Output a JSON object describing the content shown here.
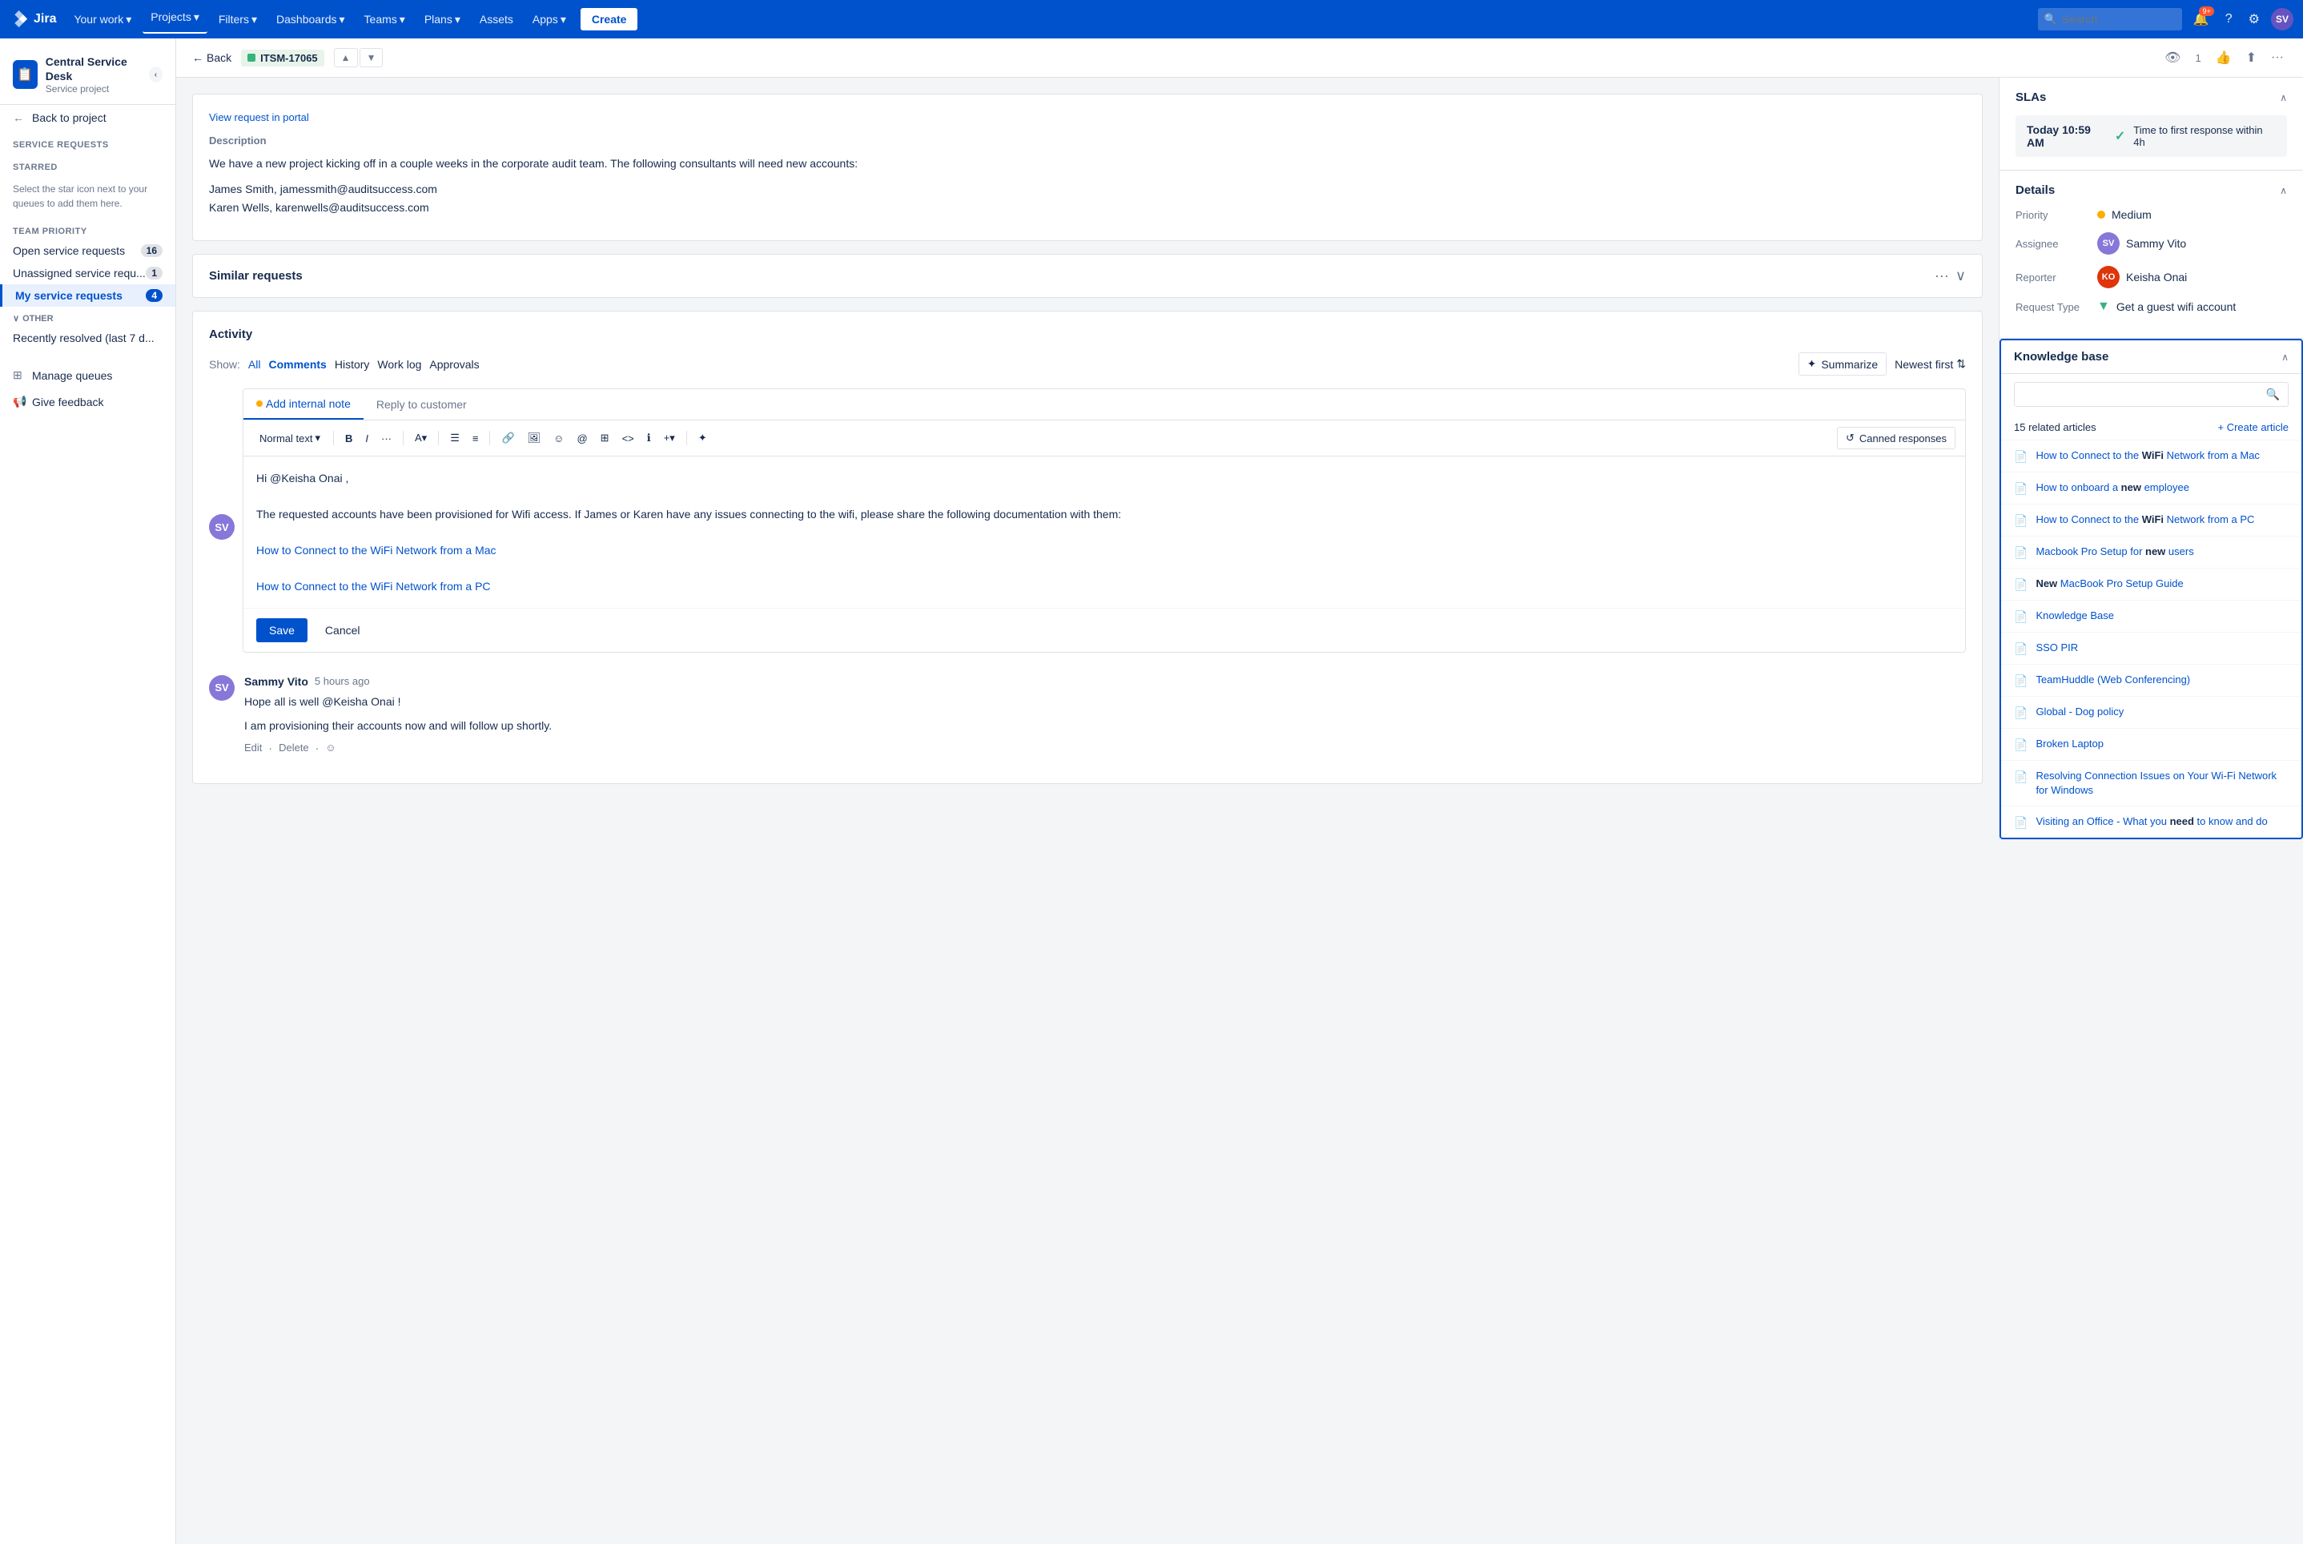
{
  "topnav": {
    "logo_text": "Jira",
    "your_work_label": "Your work",
    "projects_label": "Projects",
    "filters_label": "Filters",
    "dashboards_label": "Dashboards",
    "teams_label": "Teams",
    "plans_label": "Plans",
    "assets_label": "Assets",
    "apps_label": "Apps",
    "create_label": "Create",
    "search_placeholder": "Search",
    "notification_count": "9+",
    "avatar_initials": "SV"
  },
  "sidebar": {
    "project_name": "Central Service Desk",
    "project_type": "Service project",
    "back_to_project": "Back to project",
    "service_requests_title": "Service requests",
    "starred_title": "STARRED",
    "starred_message": "Select the star icon next to your queues to add them here.",
    "team_priority_title": "TEAM PRIORITY",
    "queues": [
      {
        "label": "Open service requests",
        "count": "16"
      },
      {
        "label": "Unassigned service requ...",
        "count": "1"
      },
      {
        "label": "My service requests",
        "count": "4",
        "active": true
      }
    ],
    "other_title": "OTHER",
    "other_items": [
      {
        "label": "Recently resolved (last 7 d..."
      }
    ],
    "manage_queues": "Manage queues",
    "give_feedback": "Give feedback"
  },
  "ticket": {
    "back_label": "Back",
    "ticket_id": "ITSM-17065",
    "view_portal_label": "View request in portal",
    "description_label": "Description",
    "description_text": "We have a new project kicking off in a couple weeks in the corporate audit team. The following consultants will need new accounts:",
    "description_users": [
      "James Smith, jamessmith@auditsuccess.com",
      "Karen Wells, karenwells@auditsuccess.com"
    ],
    "similar_requests_label": "Similar requests",
    "activity_label": "Activity",
    "show_label": "Show:",
    "filter_all": "All",
    "filter_comments": "Comments",
    "filter_history": "History",
    "filter_worklog": "Work log",
    "filter_approvals": "Approvals",
    "summarize_label": "Summarize",
    "newest_first_label": "Newest first",
    "add_internal_note_tab": "Add internal note",
    "reply_to_customer_tab": "Reply to customer",
    "editor_format_dropdown": "Normal text",
    "editor_bold": "B",
    "editor_italic": "I",
    "editor_more": "···",
    "canned_responses_label": "Canned responses",
    "editor_greeting": "Hi @Keisha Onai ,",
    "editor_body": "The requested accounts have been provisioned for Wifi access. If James or Karen have any issues connecting to the wifi, please share the following documentation with them:",
    "editor_link1": "How to Connect to the WiFi Network from a Mac",
    "editor_link2": "How to Connect to the WiFi Network from a PC",
    "save_label": "Save",
    "cancel_label": "Cancel",
    "comment": {
      "author": "Sammy Vito",
      "time": "5 hours ago",
      "text1": "Hope all is well @Keisha Onai !",
      "text2": "I am provisioning their accounts now and will follow up shortly.",
      "edit_label": "Edit",
      "delete_label": "Delete"
    }
  },
  "right_panel": {
    "slas_title": "SLAs",
    "sla_time": "Today 10:59 AM",
    "sla_label": "Time to first response within 4h",
    "details_title": "Details",
    "priority_label": "Priority",
    "priority_value": "Medium",
    "assignee_label": "Assignee",
    "assignee_value": "Sammy Vito",
    "reporter_label": "Reporter",
    "reporter_value": "Keisha Onai",
    "request_type_label": "Request Type",
    "request_type_value": "Get a guest wifi account",
    "kb_title": "Knowledge base",
    "kb_articles_count": "15 related articles",
    "kb_create_label": "+ Create article",
    "kb_articles": [
      {
        "title": "How to Connect to the ",
        "bold": "WiFi",
        "rest": " Network from a Mac"
      },
      {
        "title": "How to onboard a ",
        "bold": "new",
        "rest": " employee"
      },
      {
        "title": "How to Connect to the ",
        "bold": "WiFi",
        "rest": " Network from a PC"
      },
      {
        "title": "Macbook Pro Setup for ",
        "bold": "new",
        "rest": " users"
      },
      {
        "title": "",
        "bold": "New",
        "rest": " MacBook Pro Setup Guide"
      },
      {
        "title": "Knowledge Base",
        "bold": "",
        "rest": ""
      },
      {
        "title": "SSO PIR",
        "bold": "",
        "rest": ""
      },
      {
        "title": "TeamHuddle (Web Conferencing)",
        "bold": "",
        "rest": ""
      },
      {
        "title": "Global - Dog policy",
        "bold": "",
        "rest": ""
      },
      {
        "title": "Broken Laptop",
        "bold": "",
        "rest": ""
      },
      {
        "title": "Resolving Connection Issues on Your Wi-Fi Network for Windows",
        "bold": "",
        "rest": ""
      },
      {
        "title": "Visiting an Office - What you ",
        "bold": "need",
        "rest": " to know and do"
      }
    ]
  }
}
